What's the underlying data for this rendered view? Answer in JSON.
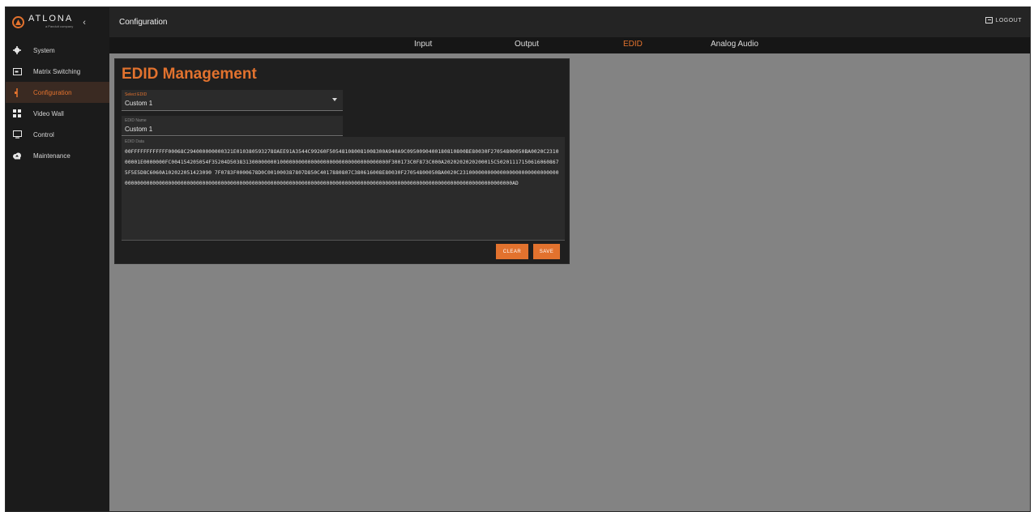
{
  "brand": {
    "name": "ATLONA",
    "tagline": "a Panduit company"
  },
  "sidebar": {
    "collapse_glyph": "‹",
    "items": [
      {
        "label": "System",
        "icon": "gear-icon",
        "active": false
      },
      {
        "label": "Matrix Switching",
        "icon": "matrix-icon",
        "active": false
      },
      {
        "label": "Configuration",
        "icon": "configuration-icon",
        "active": true
      },
      {
        "label": "Video Wall",
        "icon": "grid-icon",
        "active": false
      },
      {
        "label": "Control",
        "icon": "monitor-icon",
        "active": false
      },
      {
        "label": "Maintenance",
        "icon": "cloud-icon",
        "active": false
      }
    ]
  },
  "header": {
    "title": "Configuration",
    "logout_label": "LOGOUT"
  },
  "tabs": [
    {
      "label": "Input",
      "active": false
    },
    {
      "label": "Output",
      "active": false
    },
    {
      "label": "EDID",
      "active": true
    },
    {
      "label": "Analog Audio",
      "active": false
    }
  ],
  "edid_card": {
    "title": "EDID Management",
    "select_label": "Select EDID",
    "select_value": "Custom 1",
    "name_label": "EDID Name",
    "name_value": "Custom 1",
    "data_label": "EDID Data",
    "data_value": "00FFFFFFFFFFFF00068C294000000000321E010380593278OAEE91A3544C99260F505481080081008300A940A9C0950090400180810800BE80030F27054800050BA0020C231000001E0000000FC004154205054F35204D503831300000000100000000000000000000000000000000000F300173C0F873C000A2020202020200015C502011171506160608675F5E5D8C6060A102022051423090 7F0783F0000678D0C001000387807D850C4017880807C380616008E80030F27054800050BA0020C2310000000000000000000000000000000000000000000000000000000000000000000000000000000000000000000000000000000000000000000000000000000000000000000000000000000000AD",
    "clear_label": "CLEAR",
    "save_label": "SAVE"
  },
  "colors": {
    "accent": "#e2722e",
    "sidebar": "#1b1b1b",
    "content_bg": "#838383",
    "card": "#1f1f1f"
  }
}
